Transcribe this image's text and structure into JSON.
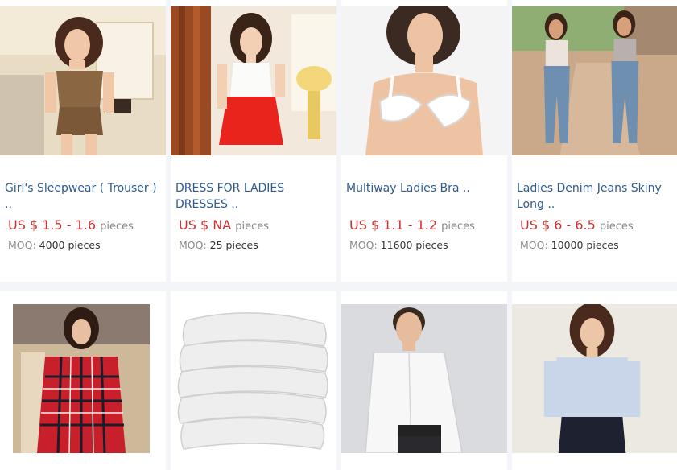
{
  "products": [
    {
      "title": "Girl's Sleepwear ( Trouser ) ..",
      "price": "US $ 1.5 - 1.6",
      "unit": "pieces",
      "moq_label": "MOQ:",
      "moq_value": "4000 pieces"
    },
    {
      "title": "DRESS FOR LADIES DRESSES ..",
      "price": "US $ NA",
      "unit": "pieces",
      "moq_label": "MOQ:",
      "moq_value": "25 pieces"
    },
    {
      "title": "Multiway Ladies Bra ..",
      "price": "US $ 1.1 - 1.2",
      "unit": "pieces",
      "moq_label": "MOQ:",
      "moq_value": "11600 pieces"
    },
    {
      "title": "Ladies Denim Jeans Skiny Long ..",
      "price": "US $ 6 - 6.5",
      "unit": "pieces",
      "moq_label": "MOQ:",
      "moq_value": "10000 pieces"
    }
  ],
  "colors": {
    "title": "#2e5a8c",
    "price": "#cc3333",
    "page_bg": "#f4f5f9"
  }
}
